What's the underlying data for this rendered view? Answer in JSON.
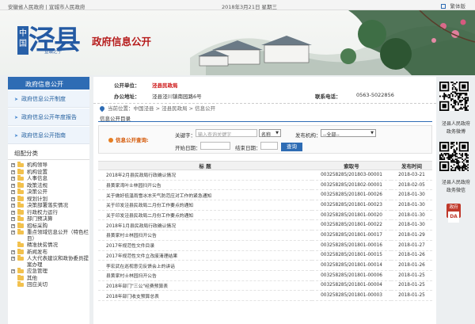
{
  "topbar": {
    "links": "安徽省人民政府 | 宣城市人民政府",
    "date": "2018年3月21日 星期三",
    "lang": "繁体版"
  },
  "banner": {
    "seal_text": "中国",
    "logo_text": "泾县",
    "logo_sub": "宣城之子",
    "title": "政府信息公开"
  },
  "sidebar": {
    "header": "政府信息公开",
    "nav": [
      {
        "label": "政府信息公开制度"
      },
      {
        "label": "政府信息公开年度报告"
      },
      {
        "label": "政府信息公开指南"
      }
    ],
    "category_title": "组配分类",
    "tree": [
      {
        "label": "机构领导",
        "pm": "+"
      },
      {
        "label": "机构设置",
        "pm": "+"
      },
      {
        "label": "人事信息",
        "pm": "+"
      },
      {
        "label": "政策法规",
        "pm": "+"
      },
      {
        "label": "决策公开",
        "pm": "+"
      },
      {
        "label": "规划计划",
        "pm": "+"
      },
      {
        "label": "决策部署落实情况",
        "pm": "+"
      },
      {
        "label": "行政权力运行",
        "pm": "+"
      },
      {
        "label": "部门预决算",
        "pm": "+"
      },
      {
        "label": "招标采购",
        "pm": "+"
      },
      {
        "label": "重点领域信息公开（特色栏目）",
        "pm": "+",
        "wrap": true
      },
      {
        "label": "精准扶贫情况",
        "pm": ""
      },
      {
        "label": "新闻发布",
        "pm": "+"
      },
      {
        "label": "人大代表建议和政协委员提案办理",
        "pm": "+",
        "wrap": true
      },
      {
        "label": "应急管理",
        "pm": "+"
      },
      {
        "label": "其他",
        "pm": ""
      },
      {
        "label": "回应关切",
        "pm": ""
      }
    ]
  },
  "unit": {
    "unit_label": "公开单位：",
    "unit_value": "泾县民政局",
    "addr_label": "办公地址：",
    "addr_value": "泾县泾川镇南园路6号",
    "tel_label": "联系电话：",
    "tel_value": "0563-5022856"
  },
  "breadcrumb": "当前位置：中国泾县 > 泾县民政局 > 信息公开",
  "directory_title": "信息公开目录",
  "search": {
    "title": "信息公开查询:",
    "keyword_label": "关键字：",
    "keyword_placeholder": "输入查询关键字",
    "field_select": "名称",
    "org_label": "发布机构：",
    "org_select": "--全部--",
    "start_label": "开始日期：",
    "end_label": "结束日期：",
    "button": "查询"
  },
  "table": {
    "headers": [
      "标   题",
      "索取号",
      "发布时间"
    ],
    "rows": [
      {
        "title": "2018年2月县民政局行政确认情况",
        "number": "003258285/201803-00001",
        "date": "2018-03-21"
      },
      {
        "title": "县黄家湾叶士林园扫开公告",
        "number": "003258285/201802-00001",
        "date": "2018-02-05"
      },
      {
        "title": "关于做好低温雨雪冰冻天气防范应对工作的紧急通知",
        "number": "003258285/201801-00026",
        "date": "2018-01-30"
      },
      {
        "title": "关于印发泾县民政局二月份工作要点的通知",
        "number": "003258285/201801-00023",
        "date": "2018-01-30"
      },
      {
        "title": "关于印发泾县民政局二月份工作要点的通知",
        "number": "003258285/201801-00020",
        "date": "2018-01-30"
      },
      {
        "title": "2018年1月县民政局行政确认情况",
        "number": "003258285/201801-00022",
        "date": "2018-01-30"
      },
      {
        "title": "县黄家村士林园扫开公告",
        "number": "003258285/201801-00017",
        "date": "2018-01-29"
      },
      {
        "title": "2017年规范性文件目录",
        "number": "003258285/201801-00016",
        "date": "2018-01-27"
      },
      {
        "title": "2017年规范性文件立改废清理结果",
        "number": "003258285/201801-00015",
        "date": "2018-01-26"
      },
      {
        "title": "李宏武在巡视意见反馈会上的讲话",
        "number": "003258285/201801-00014",
        "date": "2018-01-26"
      },
      {
        "title": "县黄家村士林园扫开公告",
        "number": "003258285/201801-00006",
        "date": "2018-01-25"
      },
      {
        "title": "2018年部门\"三公\"经费预算表",
        "number": "003258285/201801-00004",
        "date": "2018-01-25"
      },
      {
        "title": "2018年部门收支预算总表",
        "number": "003258285/201801-00003",
        "date": "2018-01-25"
      }
    ]
  },
  "right": {
    "qr1_caption1": "泾县人民政府",
    "qr1_caption2": "政务微博",
    "qr2_caption1": "泾县人民政府",
    "qr2_caption2": "政务微信",
    "badge_text": "DA",
    "badge_top": "政府"
  }
}
